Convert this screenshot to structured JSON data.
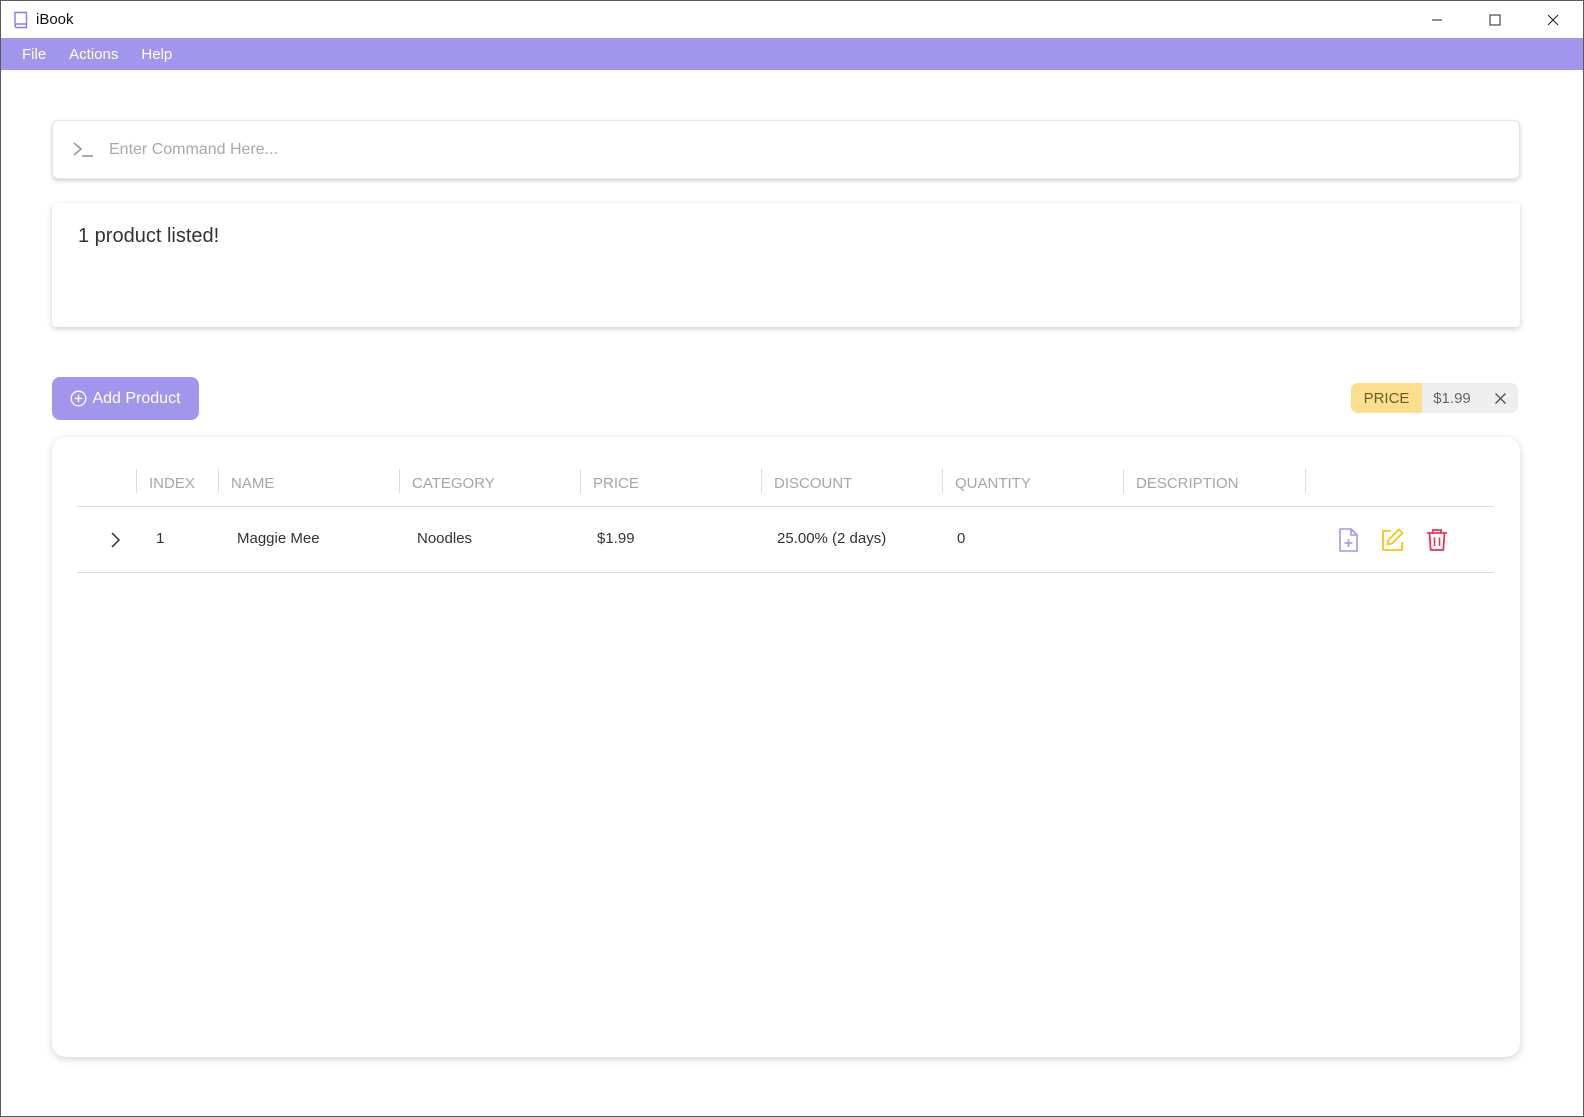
{
  "window": {
    "title": "iBook"
  },
  "menu": {
    "items": [
      "File",
      "Actions",
      "Help"
    ]
  },
  "command": {
    "placeholder": "Enter Command Here...",
    "value": ""
  },
  "result": {
    "message": "1 product listed!"
  },
  "toolbar": {
    "add_label": "Add Product"
  },
  "filter": {
    "key": "PRICE",
    "value": "$1.99"
  },
  "table": {
    "columns": [
      "INDEX",
      "NAME",
      "CATEGORY",
      "PRICE",
      "DISCOUNT",
      "QUANTITY",
      "DESCRIPTION"
    ],
    "rows": [
      {
        "index": "1",
        "name": "Maggie Mee",
        "category": "Noodles",
        "price": "$1.99",
        "discount": "25.00% (2 days)",
        "quantity": "0",
        "description": ""
      }
    ]
  },
  "colors": {
    "accent": "#a196ec",
    "chip_key": "#fbdf8e",
    "edit": "#f5c518",
    "delete": "#e8335b"
  },
  "icons": {
    "app": "book-icon",
    "prompt": "terminal-prompt-icon",
    "add": "plus-circle-icon",
    "chip_close": "close-icon",
    "expand": "chevron-right-icon",
    "row_actions": [
      "file-plus-icon",
      "edit-icon",
      "trash-icon"
    ]
  }
}
